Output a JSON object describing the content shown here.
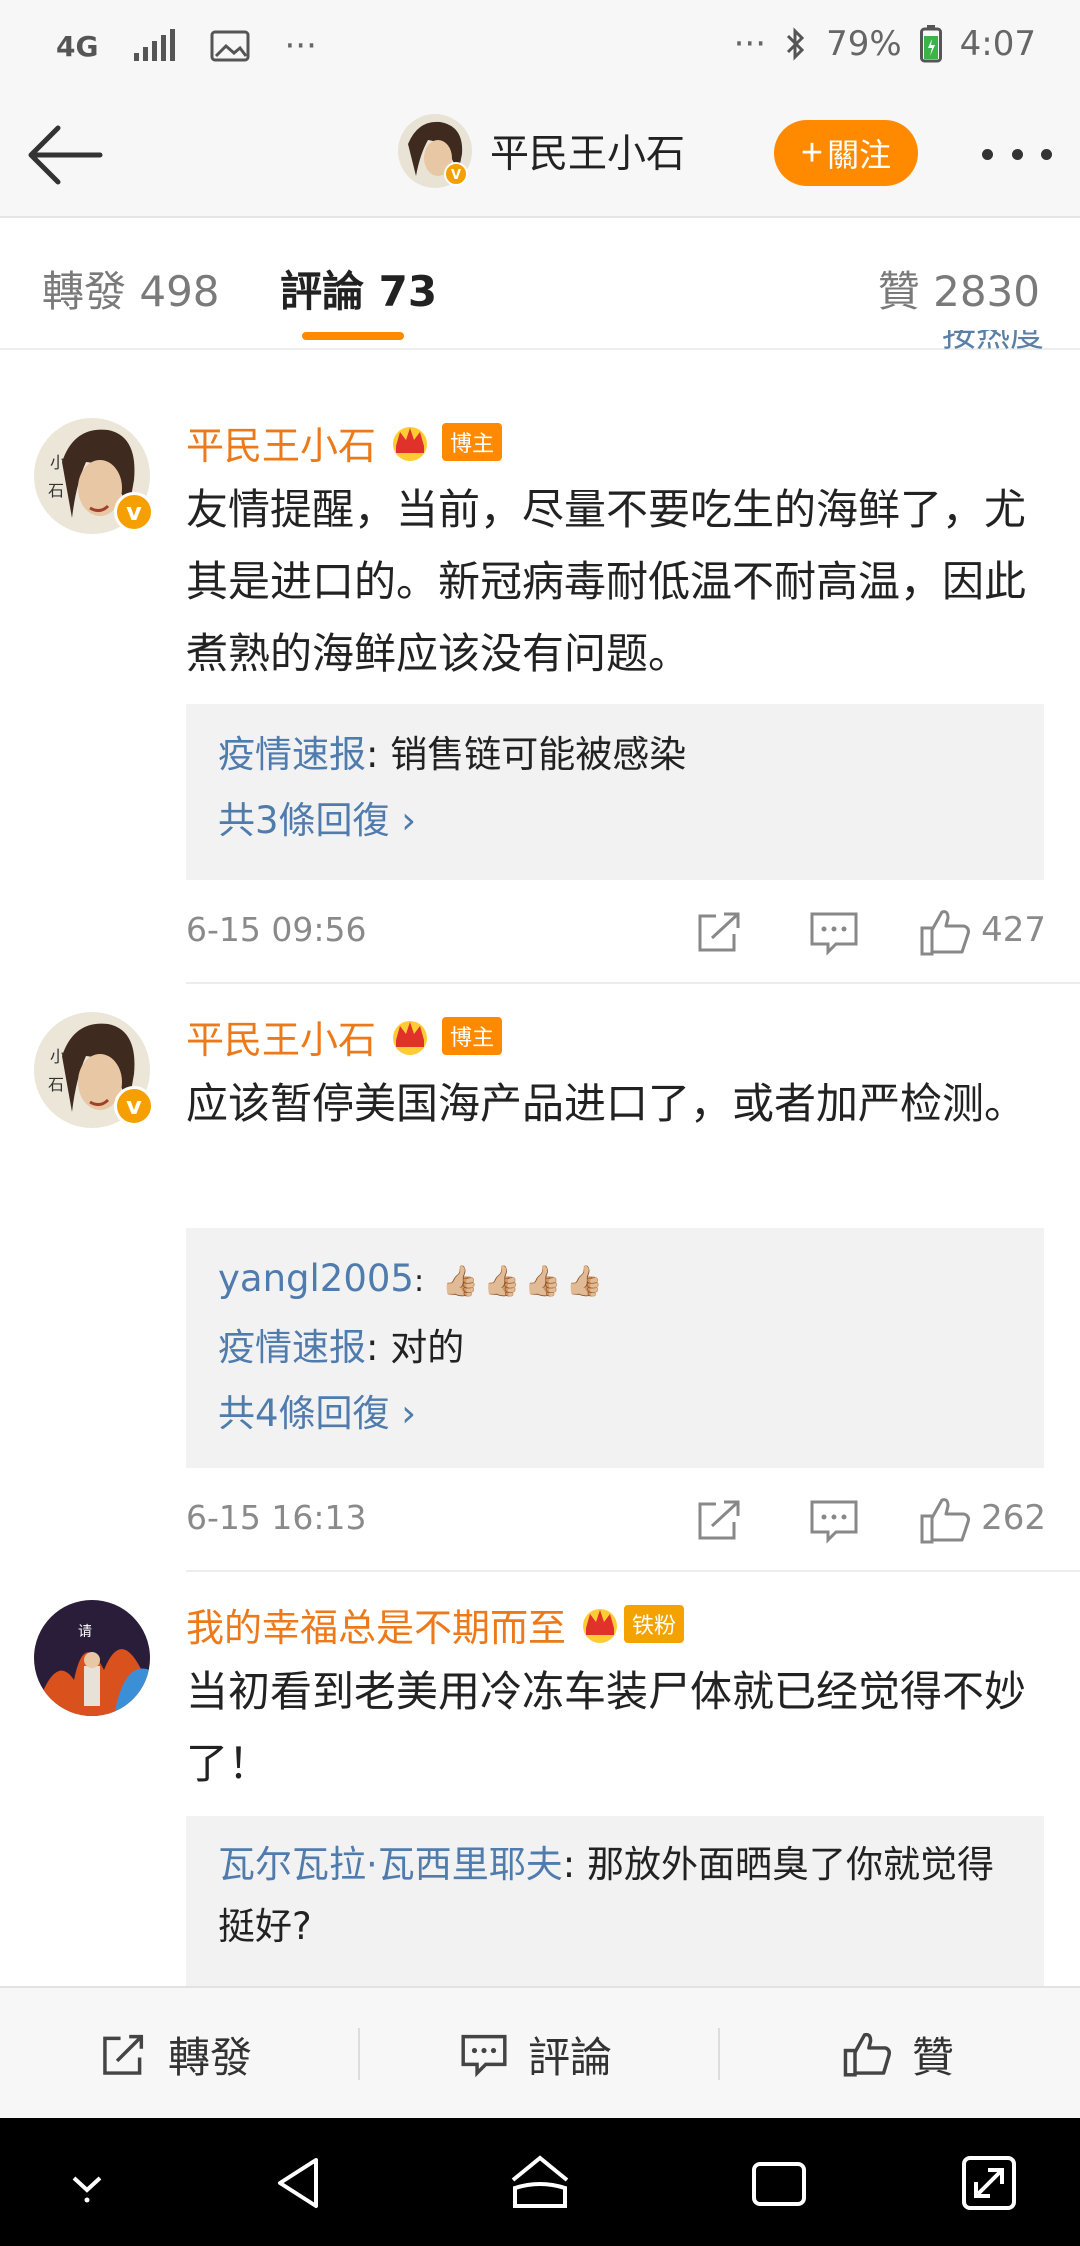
{
  "status_bar": {
    "network": "4G",
    "more": "···",
    "more_right": "···",
    "battery": "79%",
    "time": "4:07"
  },
  "header": {
    "title": "平民王小石",
    "follow_label": "關注",
    "back_icon": "back-arrow-icon",
    "more_icon": "more-dots-icon"
  },
  "tabs": [
    {
      "label": "轉發 498"
    },
    {
      "label": "評論 73"
    },
    {
      "label": "贊 2830"
    }
  ],
  "peek_text": "按热度",
  "comments": [
    {
      "user": "平民王小石",
      "badge": "博主",
      "text": "友情提醒，当前，尽量不要吃生的海鲜了，尤其是进口的。新冠病毒耐低温不耐高温，因此煮熟的海鲜应该没有问题。",
      "replies": [
        {
          "user": "疫情速报",
          "text": ": 销售链可能被感染"
        }
      ],
      "more_replies": "共3條回復 ›",
      "time": "6-15 09:56",
      "likes": "427"
    },
    {
      "user": "平民王小石",
      "badge": "博主",
      "text": "应该暂停美国海产品进口了，或者加严检测。",
      "replies": [
        {
          "user": "yangl2005",
          "text": ": 👍🏼👍🏼👍🏼👍🏼"
        },
        {
          "user": "疫情速报",
          "text": ": 对的"
        }
      ],
      "more_replies": "共4條回復 ›",
      "time": "6-15 16:13",
      "likes": "262"
    },
    {
      "user": "我的幸福总是不期而至",
      "badge": "铁粉",
      "text": "当初看到老美用冷冻车装尸体就已经觉得不妙了！",
      "replies": [
        {
          "user": "瓦尔瓦拉·瓦西里耶夫",
          "text": ": 那放外面晒臭了你就觉得挺好?"
        }
      ]
    }
  ],
  "bottom_bar": {
    "repost": "轉發",
    "comment": "評論",
    "like": "贊"
  },
  "colors": {
    "accent": "#ff8a00",
    "username": "#ec7a1a",
    "link": "#4f7bad"
  }
}
